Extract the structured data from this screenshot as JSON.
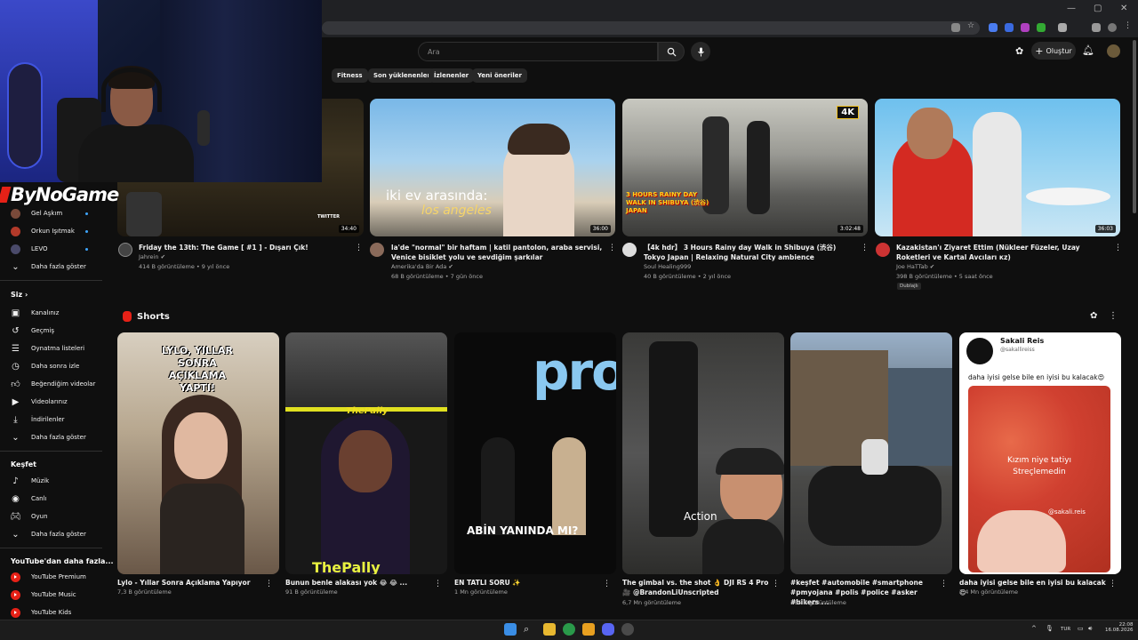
{
  "masthead": {
    "search_placeholder": "Ara",
    "create_label": "Oluştur"
  },
  "chips": [
    "Fitness",
    "Son yüklenenler",
    "İzlenenler",
    "Yeni öneriler"
  ],
  "overlay": {
    "logo_text": "ByNoGame"
  },
  "sidebar": {
    "subscriptions": [
      {
        "label": "Gel Aşkım",
        "color": "#7a4a3a"
      },
      {
        "label": "Orkun Işıtmak",
        "color": "#b33a2a"
      },
      {
        "label": "LEVO",
        "color": "#4a4a6a"
      }
    ],
    "subs_more": "Daha fazla göster",
    "you_heading": "Siz",
    "you_items": [
      {
        "label": "Kanalınız",
        "icon": "channel-icon"
      },
      {
        "label": "Geçmiş",
        "icon": "history-icon"
      },
      {
        "label": "Oynatma listeleri",
        "icon": "playlist-icon"
      },
      {
        "label": "Daha sonra izle",
        "icon": "clock-icon"
      },
      {
        "label": "Beğendiğim videolar",
        "icon": "like-icon"
      },
      {
        "label": "Videolarınız",
        "icon": "video-icon"
      },
      {
        "label": "İndirilenler",
        "icon": "download-icon"
      },
      {
        "label": "Daha fazla göster",
        "icon": "chevron-down-icon"
      }
    ],
    "explore_heading": "Keşfet",
    "explore_items": [
      {
        "label": "Müzik",
        "icon": "music-icon"
      },
      {
        "label": "Canlı",
        "icon": "live-icon"
      },
      {
        "label": "Oyun",
        "icon": "gaming-icon"
      },
      {
        "label": "Daha fazla göster",
        "icon": "chevron-down-icon"
      }
    ],
    "more_heading": "YouTube'dan daha fazla...",
    "more_items": [
      {
        "label": "YouTube Premium"
      },
      {
        "label": "YouTube Music"
      },
      {
        "label": "YouTube Kids"
      }
    ]
  },
  "videos": [
    {
      "title": "Friday the 13th: The Game [ #1 ] - Dışarı Çık!",
      "channel": "Jahrein",
      "verified": true,
      "views": "414 B görüntüleme",
      "age": "9 yıl önce",
      "duration": "34:40",
      "avatar_color": "#444"
    },
    {
      "title": "la'de \"normal\" bir haftam | katil pantolon, araba servisi, Venice bisiklet yolu ve sevdiğim şarkılar",
      "thumb_caption": "iki ev arasında:",
      "thumb_caption2": "los angeles",
      "channel": "Amerika'da Bir Ada",
      "verified": true,
      "views": "68 B görüntüleme",
      "age": "7 gün önce",
      "duration": "36:00",
      "avatar_color": "#8a6a5a"
    },
    {
      "title": "【4k hdr】 3 Hours Rainy day Walk in Shibuya (渋谷) Tokyo Japan | Relaxing Natural City ambience",
      "thumb_caption": "3 HOURS RAINY DAY WALK IN SHIBUYA (渋谷) JAPAN",
      "badge": "4K",
      "channel": "Soul Healing999",
      "verified": false,
      "views": "40 B görüntüleme",
      "age": "2 yıl önce",
      "duration": "3:02:48",
      "avatar_color": "#ddd"
    },
    {
      "title": "Kazakistan'ı Ziyaret Ettim (Nükleer Füzeler, Uzay Roketleri ve Kartal Avcıları кz)",
      "channel": "Joe HaTTab",
      "verified": true,
      "views": "398 B görüntüleme",
      "age": "5 saat önce",
      "duration": "36:03",
      "badge": "Dublajlı",
      "avatar_color": "#c33"
    }
  ],
  "shorts": {
    "heading": "Shorts",
    "items": [
      {
        "title": "Lylo - Yıllar Sonra Açıklama Yapıyor",
        "meta": "7,3 B görüntüleme",
        "caption": "LYLO, YILLAR SONRA AÇIKLAMA YAPTI!"
      },
      {
        "title": "Bunun benle alakası yok 😂 😂 ...",
        "meta": "91 B görüntüleme",
        "caption": "ThePally",
        "caption2": "ThePally"
      },
      {
        "title": "EN TATLI SORU ✨",
        "meta": "1 Mn görüntüleme",
        "caption": "ABİN YANINDA MI?",
        "caption2": "pro"
      },
      {
        "title": "The gimbal vs. the shot 👌 DJI RS 4 Pro 🎥 @BrandonLiUnscripted",
        "meta": "6,7 Mn görüntüleme",
        "caption": "Action"
      },
      {
        "title": "#keşfet #automobile #smartphone #pmyojana #polis #police #asker #bikers ...",
        "meta": "365 B görüntüleme"
      },
      {
        "title": "daha iyisi gelse bile en iyisi bu kalacak 😍",
        "meta": "2,4 Mn görüntüleme",
        "card_name": "Sakali Reis",
        "card_handle": "@sakallireiss",
        "card_text": "daha iyisi gelse bile en iyisi bu kalacak😍",
        "caption": "Kızım niye tatiyı Streçlemedin",
        "watermark": "@sakali.reis"
      }
    ]
  },
  "taskbar": {
    "lang": "TUR",
    "time": "22:08",
    "date": "16.08.2026"
  }
}
